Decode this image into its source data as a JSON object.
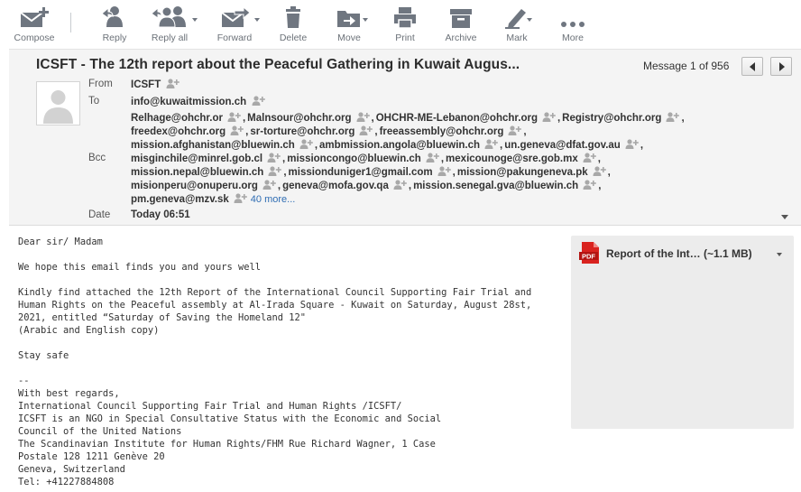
{
  "toolbar": {
    "compose": "Compose",
    "reply": "Reply",
    "reply_all": "Reply all",
    "forward": "Forward",
    "delete": "Delete",
    "move": "Move",
    "print": "Print",
    "archive": "Archive",
    "mark": "Mark",
    "more": "More"
  },
  "header": {
    "subject": "ICSFT - The 12th report about the Peaceful Gathering in Kuwait Augus...",
    "message_counter": "Message 1 of 956",
    "from_label": "From",
    "from_value": "ICSFT",
    "to_label": "To",
    "to_value": "info@kuwaitmission.ch",
    "bcc_label": "Bcc",
    "bcc_lines": [
      [
        "Relhage@ohchr.or",
        "Malnsour@ohchr.org",
        "OHCHR-ME-Lebanon@ohchr.org",
        "Registry@ohchr.org"
      ],
      [
        "freedex@ohchr.org",
        "sr-torture@ohchr.org",
        "freeassembly@ohchr.org"
      ],
      [
        "mission.afghanistan@bluewin.ch",
        "ambmission.angola@bluewin.ch",
        "un.geneva@dfat.gov.au"
      ],
      [
        "misginchile@minrel.gob.cl",
        "missioncongo@bluewin.ch",
        "mexicounoge@sre.gob.mx"
      ],
      [
        "mission.nepal@bluewin.ch",
        "missionduniger1@gmail.com",
        "mission@pakungeneva.pk"
      ],
      [
        "misionperu@onuperu.org",
        "geneva@mofa.gov.qa",
        "mission.senegal.gva@bluewin.ch"
      ],
      [
        "pm.geneva@mzv.sk"
      ]
    ],
    "more_recipients": "40 more...",
    "date_label": "Date",
    "date_value": "Today 06:51"
  },
  "body": {
    "lines": [
      "Dear sir/ Madam",
      "",
      "We hope this email finds you and yours well",
      "",
      "Kindly find attached the 12th Report of the International Council Supporting Fair Trial and",
      "Human Rights on the Peaceful assembly at Al-Irada Square - Kuwait on Saturday, August 28st,",
      "2021, entitled “Saturday of Saving the Homeland 12\"",
      "(Arabic and English copy)",
      "",
      "Stay safe",
      "",
      "--",
      "With best regards,",
      "International Council Supporting Fair Trial and Human Rights /ICSFT/",
      "ICSFT is an NGO in Special Consultative Status with the Economic and Social",
      "Council of the United Nations",
      "The Scandinavian Institute for Human Rights/FHM Rue Richard Wagner, 1 Case",
      "Postale 128 1211 Genève 20",
      "Geneva, Switzerland",
      "Tel: +41227884808"
    ]
  },
  "attachment": {
    "icon": "pdf-icon",
    "badge": "PDF",
    "name": "Report of the Int… (~1.1 MB)"
  },
  "colors": {
    "icon_gray": "#6f7680",
    "header_bg": "#f4f4f4",
    "link": "#2f6db3",
    "pdf_red": "#d9231f"
  }
}
